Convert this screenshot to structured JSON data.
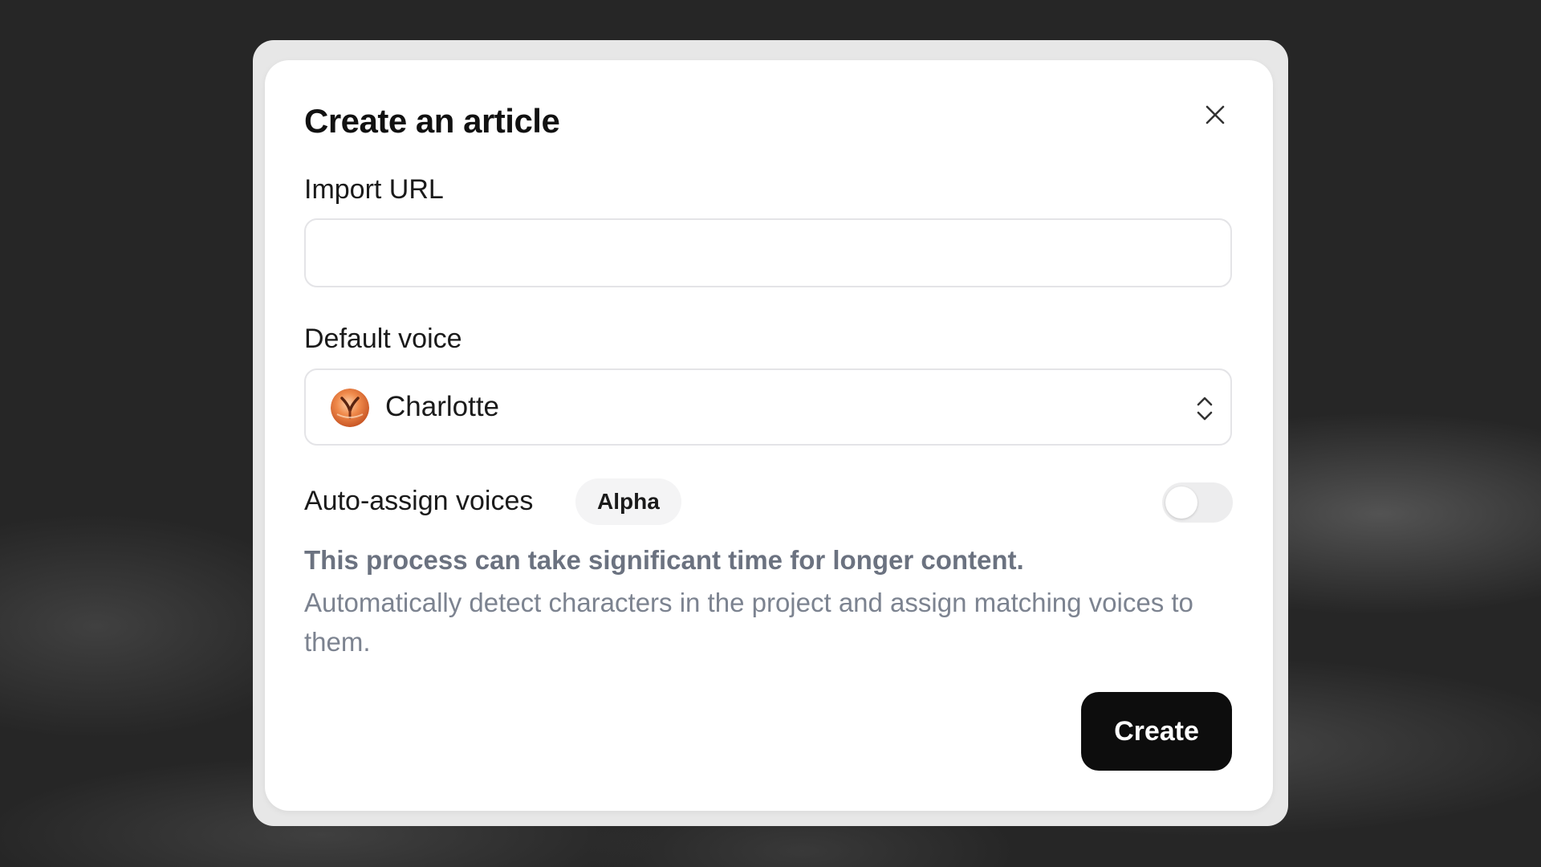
{
  "dialog": {
    "title": "Create an article",
    "close_icon": "close-icon",
    "import_url": {
      "label": "Import URL",
      "value": "",
      "placeholder": ""
    },
    "default_voice": {
      "label": "Default voice",
      "selected": "Charlotte",
      "avatar_colors": [
        "#f08a4b",
        "#c24e1f",
        "#ffd0a8"
      ]
    },
    "auto_assign": {
      "label": "Auto-assign voices",
      "badge": "Alpha",
      "enabled": false
    },
    "description": {
      "warning": "This process can take significant time for longer content.",
      "text": "Automatically detect characters in the project and assign matching voices to them."
    },
    "create_button": "Create"
  }
}
